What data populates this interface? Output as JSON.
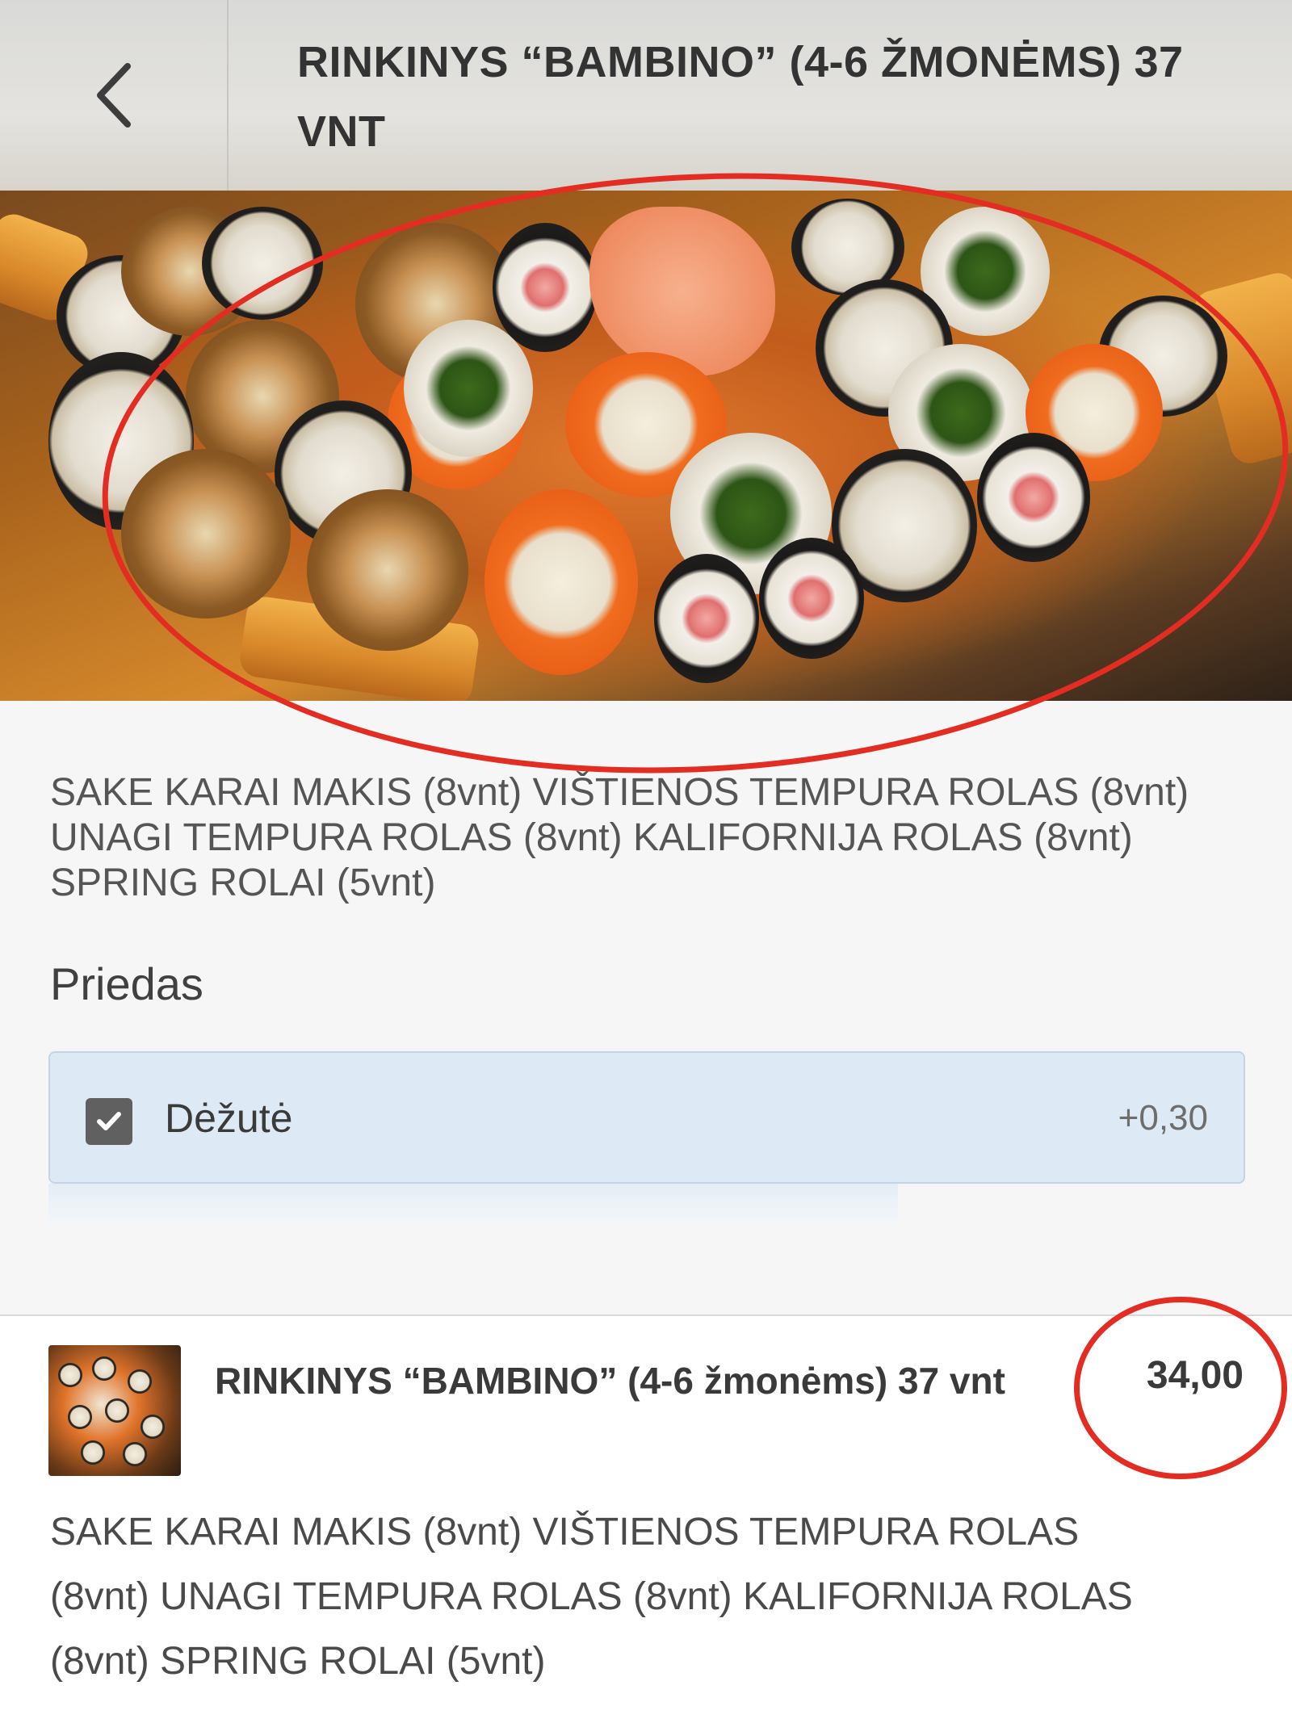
{
  "header": {
    "title": "RINKINYS “BAMBINO” (4-6 ŽMONĖMS) 37 VNT",
    "back_icon": "chevron-left-icon"
  },
  "product": {
    "description": "SAKE KARAI MAKIS (8vnt) VIŠTIENOS TEMPURA ROLAS (8vnt) UNAGI TEMPURA ROLAS (8vnt) KALIFORNIJA ROLAS (8vnt) SPRING ROLAI (5vnt)"
  },
  "addons": {
    "section_label": "Priedas",
    "options": [
      {
        "label": "Dėžutė",
        "price": "+0,30",
        "checked": true
      }
    ]
  },
  "cart_item": {
    "name": "RINKINYS “BAMBINO” (4-6 žmonėms) 37 vnt",
    "price": "34,00",
    "description": "SAKE KARAI MAKIS (8vnt) VIŠTIENOS TEMPURA ROLAS (8vnt) UNAGI TEMPURA ROLAS (8vnt) KALIFORNIJA ROLAS (8vnt) SPRING ROLAI (5vnt)"
  },
  "colors": {
    "annotation": "#e32d23",
    "option_background": "#dde9f4",
    "checkbox": "#606060"
  }
}
